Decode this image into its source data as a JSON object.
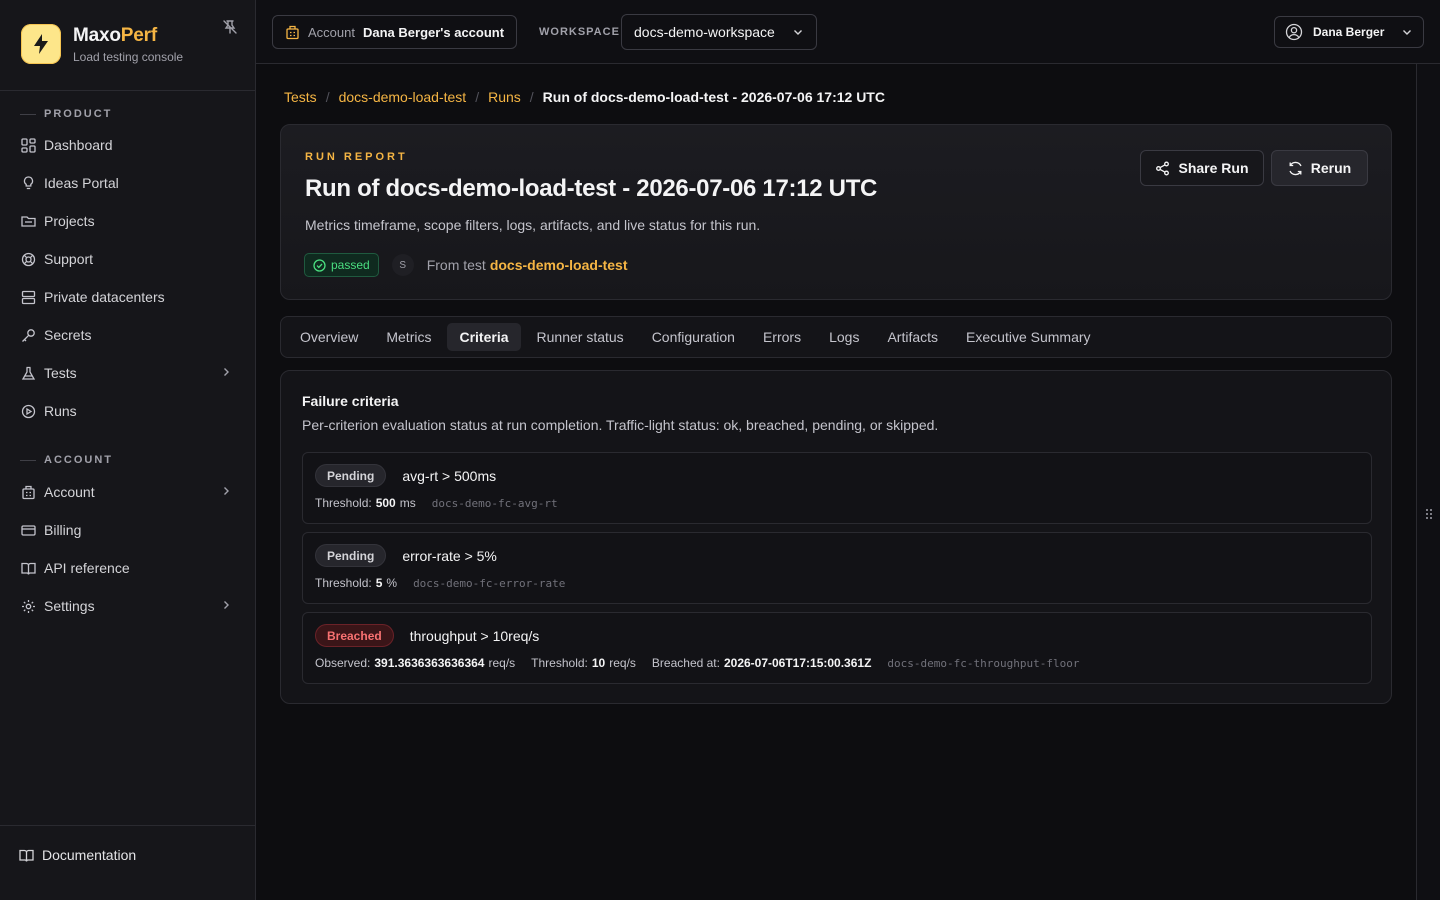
{
  "brand": {
    "name_main": "Maxo",
    "name_accent": "Perf",
    "subtitle": "Load testing console"
  },
  "sidebar": {
    "product_section": "PRODUCT",
    "product_items": [
      {
        "label": "Dashboard",
        "icon": "dashboard-icon"
      },
      {
        "label": "Ideas Portal",
        "icon": "lightbulb-icon"
      },
      {
        "label": "Projects",
        "icon": "folder-icon"
      },
      {
        "label": "Support",
        "icon": "lifebuoy-icon"
      },
      {
        "label": "Private datacenters",
        "icon": "server-icon"
      },
      {
        "label": "Secrets",
        "icon": "key-icon"
      },
      {
        "label": "Tests",
        "icon": "flask-icon",
        "expandable": true
      },
      {
        "label": "Runs",
        "icon": "play-circle-icon"
      }
    ],
    "account_section": "ACCOUNT",
    "account_items": [
      {
        "label": "Account",
        "icon": "building-icon",
        "expandable": true
      },
      {
        "label": "Billing",
        "icon": "credit-card-icon"
      },
      {
        "label": "API reference",
        "icon": "book-icon"
      },
      {
        "label": "Settings",
        "icon": "gear-icon",
        "expandable": true
      }
    ],
    "footer_label": "Documentation"
  },
  "header": {
    "account_key": "Account",
    "account_value": "Dana Berger's account",
    "workspace_label": "WORKSPACE",
    "workspace_value": "docs-demo-workspace",
    "user_name": "Dana Berger"
  },
  "breadcrumbs": {
    "items": [
      "Tests",
      "docs-demo-load-test",
      "Runs"
    ],
    "current": "Run of docs-demo-load-test - 2026-07-06 17:12 UTC",
    "separator": "/"
  },
  "run": {
    "eyebrow": "RUN REPORT",
    "title": "Run of docs-demo-load-test - 2026-07-06 17:12 UTC",
    "subtitle": "Metrics timeframe, scope filters, logs, artifacts, and live status for this run.",
    "status": "passed",
    "initial": "S",
    "from_prefix": "From test",
    "from_test": "docs-demo-load-test",
    "share_label": "Share Run",
    "rerun_label": "Rerun"
  },
  "tabs": [
    {
      "label": "Overview"
    },
    {
      "label": "Metrics"
    },
    {
      "label": "Criteria",
      "active": true
    },
    {
      "label": "Runner status"
    },
    {
      "label": "Configuration"
    },
    {
      "label": "Errors"
    },
    {
      "label": "Logs"
    },
    {
      "label": "Artifacts"
    },
    {
      "label": "Executive Summary"
    }
  ],
  "criteria": {
    "title": "Failure criteria",
    "subtitle": "Per-criterion evaluation status at run completion. Traffic-light status: ok, breached, pending, or skipped.",
    "items": [
      {
        "status": "Pending",
        "name": "avg-rt > 500ms",
        "threshold_label": "Threshold:",
        "threshold_value": "500",
        "threshold_unit": "ms",
        "id": "docs-demo-fc-avg-rt"
      },
      {
        "status": "Pending",
        "name": "error-rate > 5%",
        "threshold_label": "Threshold:",
        "threshold_value": "5",
        "threshold_unit": "%",
        "id": "docs-demo-fc-error-rate"
      },
      {
        "status": "Breached",
        "name": "throughput > 10req/s",
        "observed_label": "Observed:",
        "observed_value": "391.3636363636364",
        "observed_unit": "req/s",
        "threshold_label": "Threshold:",
        "threshold_value": "10",
        "threshold_unit": "req/s",
        "breached_label": "Breached at:",
        "breached_value": "2026-07-06T17:15:00.361Z",
        "id": "docs-demo-fc-throughput-floor"
      }
    ]
  },
  "colors": {
    "accent": "#f5b544",
    "passed": "#4ade80",
    "breached": "#f87171",
    "background": "#0d0d10",
    "sidebar": "#16161a"
  }
}
